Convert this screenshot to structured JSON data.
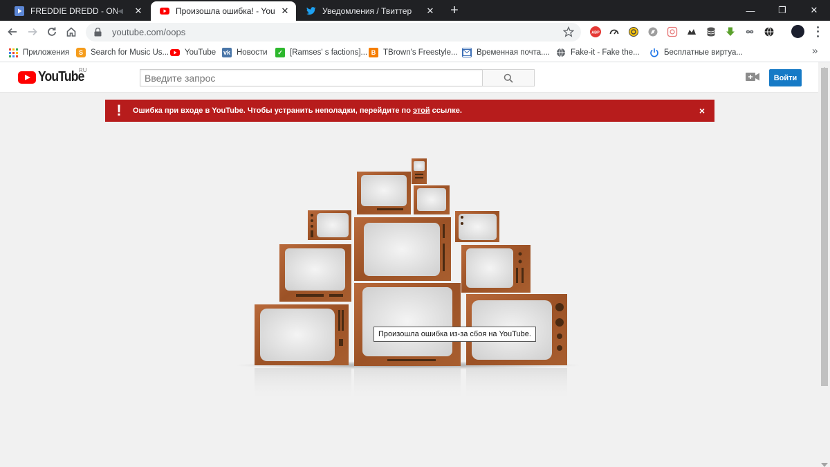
{
  "browser": {
    "tabs": [
      {
        "title": "FREDDIE DREDD - ON ME",
        "active": false
      },
      {
        "title": "Произошла ошибка! - YouTube",
        "active": true
      },
      {
        "title": "Уведомления / Твиттер",
        "active": false
      }
    ],
    "url": "youtube.com/oops",
    "bookmarks": [
      {
        "label": "Приложения",
        "icon": "apps-grid-icon"
      },
      {
        "label": "Search for Music Us...",
        "icon": "shazam-icon",
        "color": "#f59c1b"
      },
      {
        "label": "YouTube",
        "icon": "youtube-icon",
        "color": "#ff0000"
      },
      {
        "label": "Новости",
        "icon": "vk-icon",
        "color": "#4a76a8"
      },
      {
        "label": "[Ramses' s factions]...",
        "icon": "green-site-icon",
        "color": "#2eb82e"
      },
      {
        "label": "TBrown's Freestyle...",
        "icon": "blogger-icon",
        "color": "#f57d00"
      },
      {
        "label": "Временная почта....",
        "icon": "mail-icon",
        "color": "#3d6fb6"
      },
      {
        "label": "Fake-it - Fake the...",
        "icon": "globe-icon",
        "color": "#5f6368"
      },
      {
        "label": "Бесплатные виртуа...",
        "icon": "power-icon",
        "color": "#1a73e8"
      }
    ]
  },
  "youtube": {
    "logo_word": "YouTube",
    "region": "RU",
    "search_placeholder": "Введите запрос",
    "signin_label": "Войти"
  },
  "alert": {
    "icon": "!",
    "text_before": "Ошибка при входе в YouTube. Чтобы устранить неполадки, перейдите по ",
    "link_text": "этой",
    "text_after": " ссылке.",
    "close": "×",
    "color": "#b71c1c"
  },
  "error_tooltip": "Произошла ошибка из-за сбоя на YouTube."
}
